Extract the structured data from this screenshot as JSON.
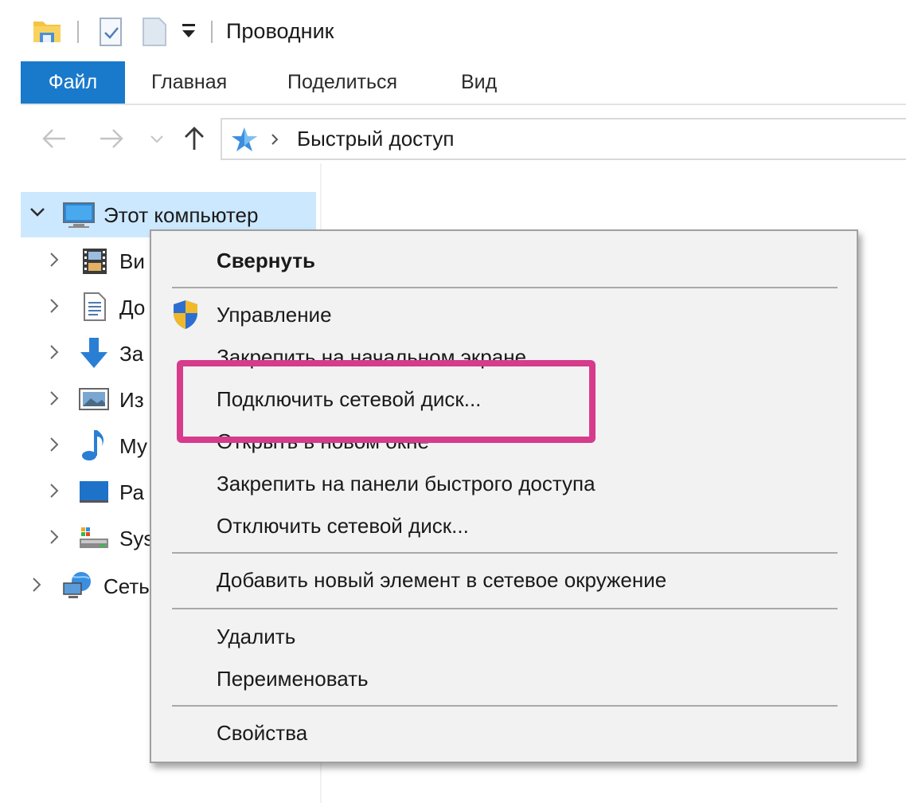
{
  "window": {
    "title": "Проводник"
  },
  "ribbon": {
    "tabs": [
      "Файл",
      "Главная",
      "Поделиться",
      "Вид"
    ]
  },
  "address_bar": {
    "path": [
      "Быстрый доступ"
    ]
  },
  "nav_tree": {
    "root": {
      "label": "Этот компьютер",
      "expanded": true,
      "selected": true
    },
    "children": [
      {
        "label": "Ви",
        "icon": "video-icon"
      },
      {
        "label": "До",
        "icon": "document-icon"
      },
      {
        "label": "За",
        "icon": "download-icon"
      },
      {
        "label": "Из",
        "icon": "image-icon"
      },
      {
        "label": "Му",
        "icon": "music-icon"
      },
      {
        "label": "Ра",
        "icon": "desktop-icon"
      },
      {
        "label": "Sys",
        "icon": "drive-icon"
      }
    ],
    "network": {
      "label": "Сеть",
      "icon": "network-icon"
    }
  },
  "context_menu": {
    "items": [
      {
        "label": "Свернуть",
        "bold": true
      },
      {
        "separator": true
      },
      {
        "label": "Управление",
        "icon": "shield-icon"
      },
      {
        "label": "Закрепить на начальном экране"
      },
      {
        "label": "Подключить сетевой диск..."
      },
      {
        "label": "Открыть в новом окне"
      },
      {
        "label": "Закрепить на панели быстрого доступа"
      },
      {
        "label": "Отключить сетевой диск..."
      },
      {
        "separator": true
      },
      {
        "label": "Добавить новый элемент в сетевое окружение"
      },
      {
        "separator": true
      },
      {
        "label": "Удалить"
      },
      {
        "label": "Переименовать"
      },
      {
        "separator": true
      },
      {
        "label": "Свойства"
      }
    ]
  },
  "highlight": {
    "color": "#d63b8c",
    "target": "Подключить сетевой диск..."
  },
  "colors": {
    "file_tab": "#1979ca",
    "selection": "#cce8ff",
    "accent": "#d63b8c"
  }
}
